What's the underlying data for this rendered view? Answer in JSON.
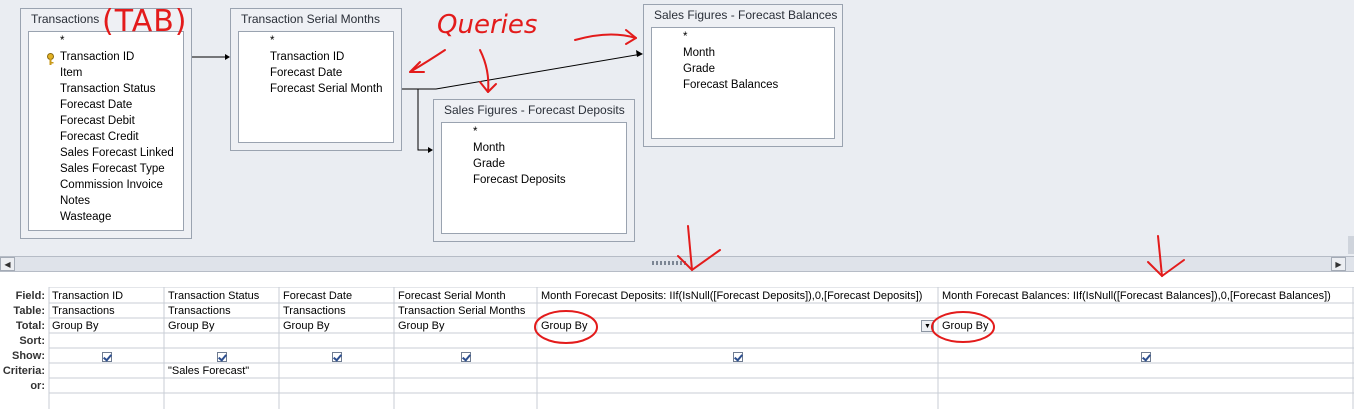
{
  "tables": [
    {
      "title": "Transactions",
      "fields": [
        "*",
        "Transaction ID",
        "Item",
        "Transaction Status",
        "Forecast Date",
        "Forecast Debit",
        "Forecast Credit",
        "Sales Forecast Linked",
        "Sales Forecast Type",
        "Commission Invoice",
        "Notes",
        "Wasteage"
      ]
    },
    {
      "title": "Transaction Serial Months",
      "fields": [
        "*",
        "Transaction ID",
        "Forecast Date",
        "Forecast Serial Month"
      ]
    },
    {
      "title": "Sales Figures - Forecast Deposits",
      "fields": [
        "*",
        "Month",
        "Grade",
        "Forecast Deposits"
      ]
    },
    {
      "title": "Sales Figures - Forecast Balances",
      "fields": [
        "*",
        "Month",
        "Grade",
        "Forecast Balances"
      ]
    }
  ],
  "grid": {
    "row_labels": [
      "Field:",
      "Table:",
      "Total:",
      "Sort:",
      "Show:",
      "Criteria:",
      "or:"
    ],
    "columns": [
      {
        "field": "Transaction ID",
        "table": "Transactions",
        "total": "Group By",
        "criteria": ""
      },
      {
        "field": "Transaction Status",
        "table": "Transactions",
        "total": "Group By",
        "criteria": "\"Sales Forecast\""
      },
      {
        "field": "Forecast Date",
        "table": "Transactions",
        "total": "Group By",
        "criteria": ""
      },
      {
        "field": "Forecast Serial Month",
        "table": "Transaction Serial Months",
        "total": "Group By",
        "criteria": ""
      },
      {
        "field": "Month Forecast Deposits: IIf(IsNull([Forecast Deposits]),0,[Forecast Deposits])",
        "table": "",
        "total": "Group By",
        "criteria": ""
      },
      {
        "field": "Month Forecast Balances: IIf(IsNull([Forecast Balances]),0,[Forecast Balances])",
        "table": "",
        "total": "Group By",
        "criteria": ""
      }
    ]
  },
  "annotations": {
    "tab": "(TAB)",
    "queries": "Queries"
  },
  "icons": {
    "primary_key": "key-icon",
    "scroll_left": "arrow-left-icon",
    "scroll_right": "arrow-right-icon",
    "dropdown": "chevron-down-icon"
  },
  "colors": {
    "ink": "#e31b1b",
    "designer_bg": "#eaedf2",
    "border": "#9aa3b0"
  }
}
